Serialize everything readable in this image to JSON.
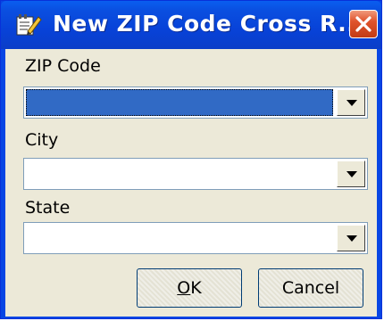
{
  "window": {
    "title": "New ZIP Code Cross R...",
    "close_icon": "close-icon",
    "app_icon": "notepad-pencil-icon"
  },
  "fields": {
    "zip": {
      "label": "ZIP Code",
      "value": ""
    },
    "city": {
      "label": "City",
      "value": ""
    },
    "state": {
      "label": "State",
      "value": ""
    }
  },
  "buttons": {
    "ok_prefix": "O",
    "ok_rest": "K",
    "cancel": "Cancel"
  },
  "colors": {
    "selection": "#316ac5",
    "title_bar": "#0a4fe0",
    "close": "#e0542c",
    "dialog_bg": "#ece9d8"
  }
}
